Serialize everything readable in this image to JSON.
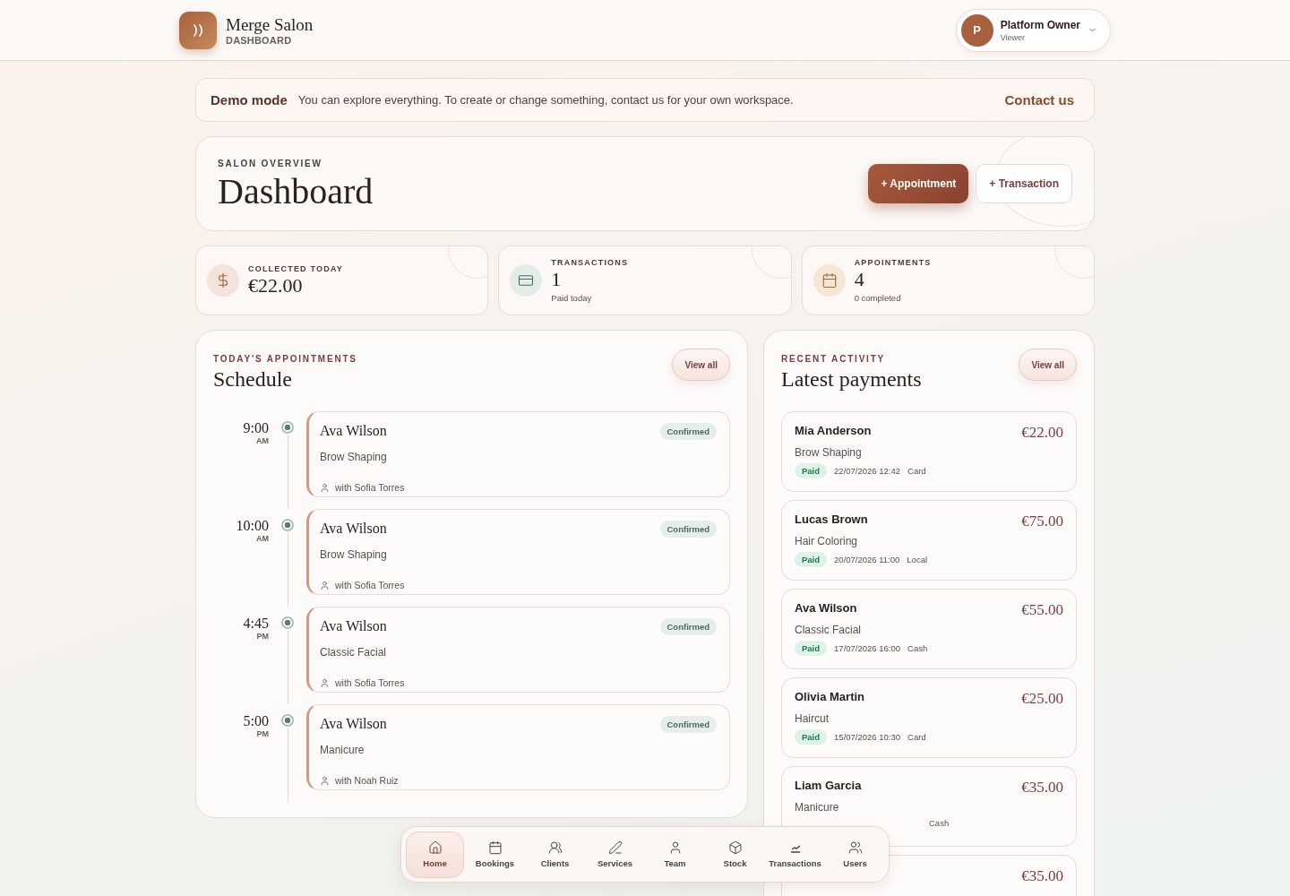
{
  "header": {
    "brand": "Merge Salon",
    "subtitle": "DASHBOARD",
    "user": {
      "initial": "P",
      "name": "Platform Owner",
      "role": "Viewer"
    }
  },
  "demo_banner": {
    "title": "Demo mode",
    "message": "You can explore everything. To create or change something, contact us for your own workspace.",
    "link": "Contact us"
  },
  "hero": {
    "eyebrow": "SALON OVERVIEW",
    "title": "Dashboard",
    "actions": [
      {
        "label": "+ Appointment",
        "kind": "primary"
      },
      {
        "label": "+ Transaction",
        "kind": "secondary"
      }
    ]
  },
  "stats": [
    {
      "label": "COLLECTED TODAY",
      "value": "€22.00"
    },
    {
      "label": "TRANSACTIONS",
      "value": "1",
      "note": "Paid today"
    },
    {
      "label": "APPOINTMENTS",
      "value": "4",
      "note": "0 completed"
    }
  ],
  "schedule": {
    "eyebrow": "TODAY'S APPOINTMENTS",
    "title": "Schedule",
    "view_all": "View all",
    "appointments": [
      {
        "time": "9:00",
        "period": "AM",
        "client": "Ava Wilson",
        "service": "Brow Shaping",
        "staff": "with Sofia Torres",
        "status": "Confirmed"
      },
      {
        "time": "10:00",
        "period": "AM",
        "client": "Ava Wilson",
        "service": "Brow Shaping",
        "staff": "with Sofia Torres",
        "status": "Confirmed"
      },
      {
        "time": "4:45",
        "period": "PM",
        "client": "Ava Wilson",
        "service": "Classic Facial",
        "staff": "with Sofia Torres",
        "status": "Confirmed"
      },
      {
        "time": "5:00",
        "period": "PM",
        "client": "Ava Wilson",
        "service": "Manicure",
        "staff": "with Noah Ruiz",
        "status": "Confirmed"
      }
    ]
  },
  "payments": {
    "eyebrow": "RECENT ACTIVITY",
    "title": "Latest payments",
    "view_all": "View all",
    "items": [
      {
        "client": "Mia Anderson",
        "service": "Brow Shaping",
        "amount": "€22.00",
        "status": {
          "label": "Paid",
          "kind": "paid"
        },
        "date": "22/07/2026 12:42",
        "method": "Card"
      },
      {
        "client": "Lucas Brown",
        "service": "Hair Coloring",
        "amount": "€75.00",
        "status": {
          "label": "Paid",
          "kind": "paid"
        },
        "date": "20/07/2026 11:00",
        "method": "Local"
      },
      {
        "client": "Ava Wilson",
        "service": "Classic Facial",
        "amount": "€55.00",
        "status": {
          "label": "Paid",
          "kind": "paid"
        },
        "date": "17/07/2026 16:00",
        "method": "Cash"
      },
      {
        "client": "Olivia Martin",
        "service": "Haircut",
        "amount": "€25.00",
        "status": {
          "label": "Paid",
          "kind": "paid"
        },
        "date": "15/07/2026 10:30",
        "method": "Card"
      },
      {
        "client": "Liam Garcia",
        "service": "Manicure",
        "amount": "€35.00",
        "method": "Cash"
      },
      {
        "amount": "€35.00"
      }
    ]
  },
  "nav": {
    "items": [
      {
        "label": "Home",
        "selected": true
      },
      {
        "label": "Bookings",
        "selected": false
      },
      {
        "label": "Clients",
        "selected": false
      },
      {
        "label": "Services",
        "selected": false
      },
      {
        "label": "Team",
        "selected": false
      },
      {
        "label": "Stock",
        "selected": false
      },
      {
        "label": "Transactions",
        "selected": false
      },
      {
        "label": "Users",
        "selected": false
      }
    ]
  }
}
